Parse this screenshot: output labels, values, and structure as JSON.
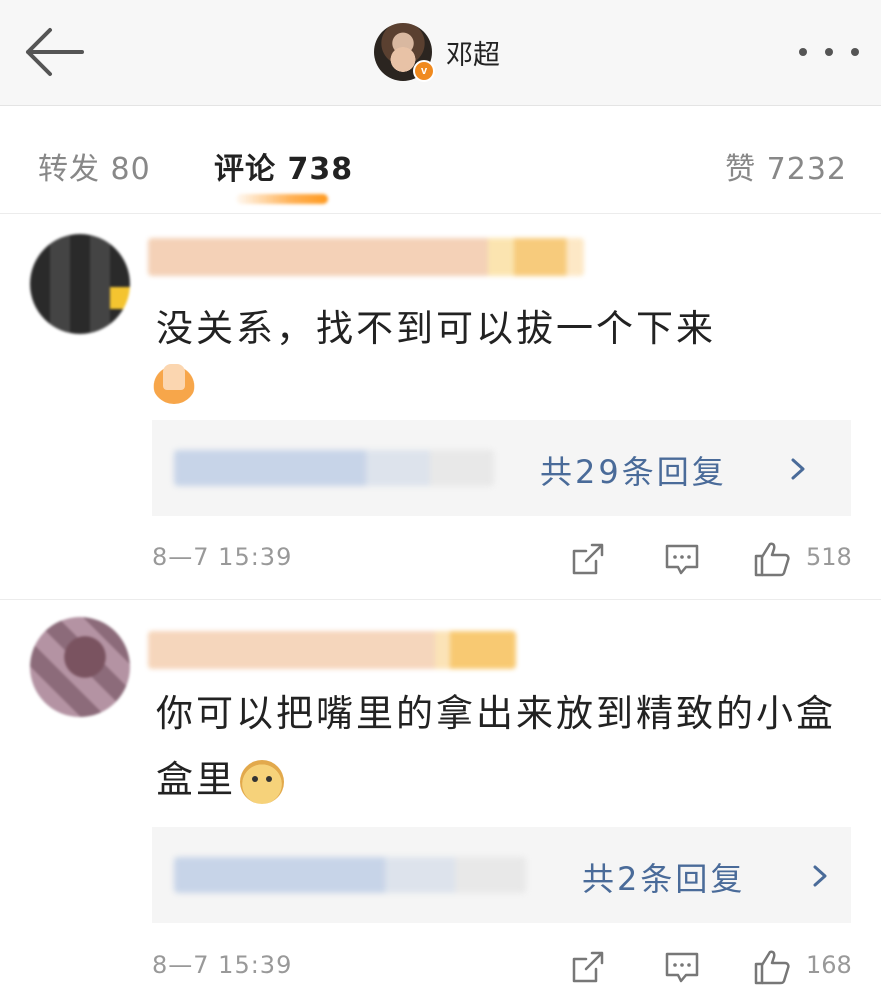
{
  "header": {
    "title": "邓超",
    "badge": "v",
    "back_icon": "back-arrow-icon",
    "more_icon": "more-dots-icon"
  },
  "tabs": {
    "repost": "转发 80",
    "comment": "评论 738",
    "like": "赞 7232",
    "active": "comment"
  },
  "comments": [
    {
      "text": "没关系，找不到可以拔一个下来",
      "emoji": "folded-hands-emoji",
      "reply_link": "共29条回复",
      "time": "8—7 15:39",
      "likes": "518"
    },
    {
      "text": "你可以把嘴里的拿出来放到精致的小盒盒里",
      "emoji": "doge-emoji",
      "reply_link": "共2条回复",
      "time": "8—7 15:39",
      "likes": "168"
    }
  ],
  "colors": {
    "accent": "#ff9a1f",
    "link": "#4a6b99",
    "muted": "#999999",
    "header_bg": "#f7f7f7"
  }
}
